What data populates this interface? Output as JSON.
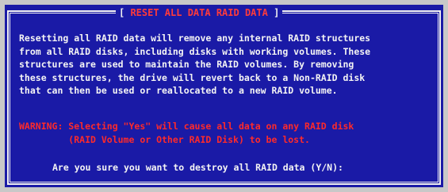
{
  "dialog": {
    "title_open": "[ ",
    "title": "RESET ALL DATA RAID DATA",
    "title_close": " ]",
    "body_lines": [
      "Resetting all RAID data will remove any internal RAID structures",
      "from all RAID disks, including disks with working volumes. These",
      "structures are used to maintain the RAID volumes. By removing",
      "these structures, the drive will revert back to a Non-RAID disk",
      "that can then be used or reallocated to a new RAID volume."
    ],
    "warning_lines": [
      "WARNING: Selecting \"Yes\" will cause all data on any RAID disk",
      "         (RAID Volume or Other RAID Disk) to be lost."
    ],
    "prompt": "Are you sure you want to destroy all RAID data (Y/N):"
  },
  "colors": {
    "dialog_bg": "#1a1aa6",
    "text": "#f4f4f4",
    "warning": "#ff2a2a",
    "title": "#ff3b3b",
    "page_bg": "#c8c8c8"
  }
}
